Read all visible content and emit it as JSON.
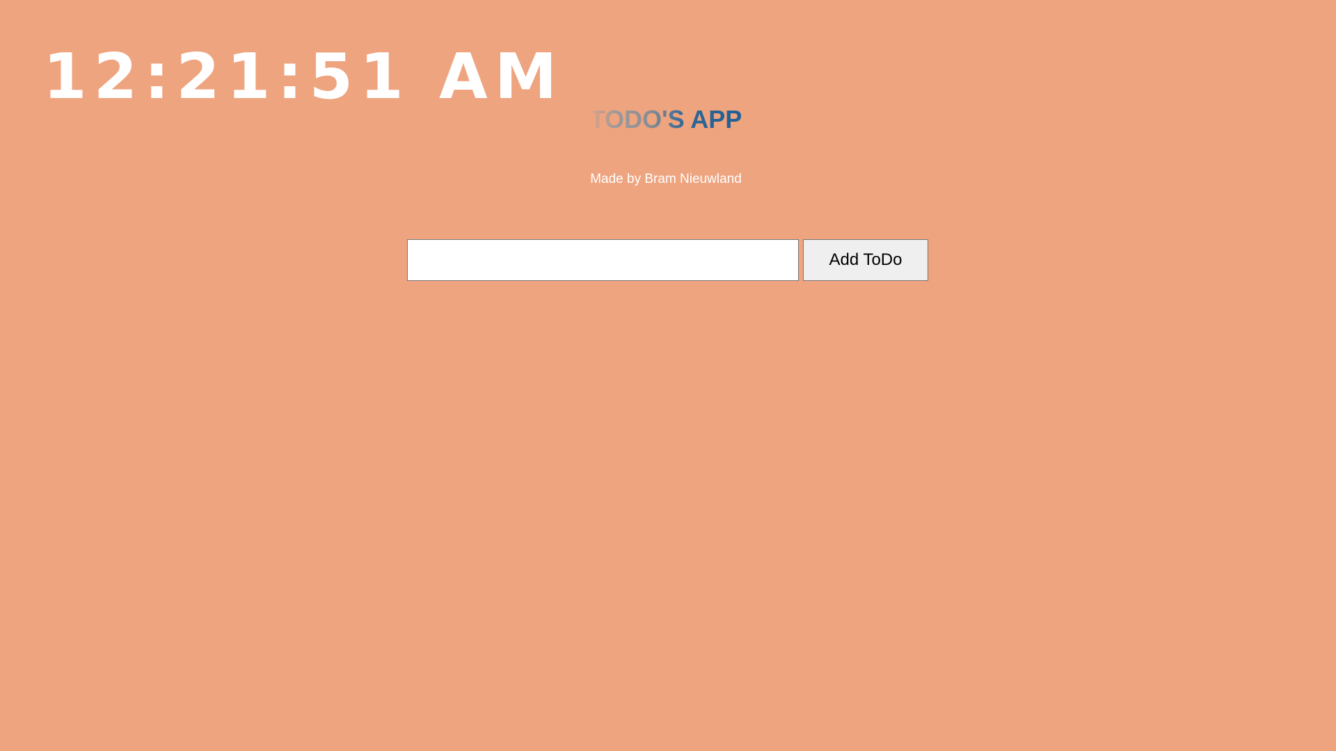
{
  "clock": {
    "time": "12:21:51 AM"
  },
  "header": {
    "title": "TODO'S APP",
    "subtitle": "Made by Bram Nieuwland"
  },
  "form": {
    "input_value": "",
    "input_placeholder": "",
    "add_button_label": "Add ToDo"
  },
  "colors": {
    "background": "#EEA47F",
    "title_accent": "#1E5E96",
    "title_muted": "#9E9A9A",
    "text": "#FFFFFF"
  }
}
